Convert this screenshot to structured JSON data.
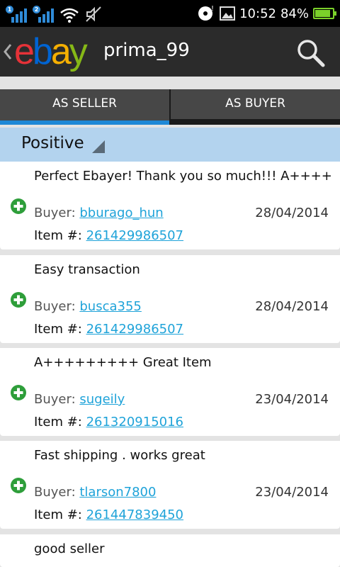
{
  "status_bar": {
    "sim1": "1",
    "sim2": "2",
    "time": "10:52",
    "battery": "84%",
    "icons": [
      "signal-icon",
      "wifi-icon",
      "mute-icon",
      "alarm-icon",
      "image-icon",
      "battery-icon"
    ]
  },
  "app_bar": {
    "logo": {
      "e": "e",
      "b": "b",
      "a": "a",
      "y": "y"
    },
    "title": "prima_99",
    "colors": {
      "e": "#e53238",
      "b": "#0064d2",
      "a": "#f5af02",
      "y": "#86b817"
    }
  },
  "tabs": [
    {
      "label": "AS SELLER",
      "selected": true
    },
    {
      "label": "AS BUYER",
      "selected": false
    }
  ],
  "filter": {
    "selected": "Positive"
  },
  "labels": {
    "buyer": "Buyer: ",
    "item": "Item #: "
  },
  "feedback": [
    {
      "comment": "Perfect Ebayer! Thank you so much!!! A++++",
      "buyer": "bburago_hun",
      "date": "28/04/2014",
      "item": "261429986507"
    },
    {
      "comment": "Easy transaction",
      "buyer": "busca355",
      "date": "28/04/2014",
      "item": "261429986507"
    },
    {
      "comment": "A+++++++++ Great Item",
      "buyer": "sugeily",
      "date": "23/04/2014",
      "item": "261320915016"
    },
    {
      "comment": "Fast shipping . works great",
      "buyer": "tlarson7800",
      "date": "23/04/2014",
      "item": "261447839450"
    },
    {
      "comment": "good seller",
      "buyer": "",
      "date": "",
      "item": ""
    }
  ],
  "accent_color": "#1e88d6",
  "link_color": "#1fa3d9",
  "positive_color": "#2e9e3a"
}
